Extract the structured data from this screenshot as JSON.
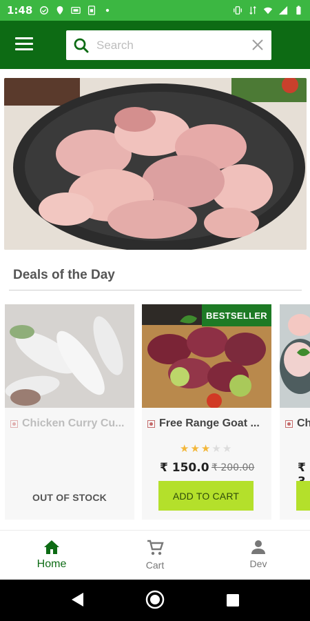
{
  "status_bar": {
    "time": "1:48"
  },
  "header": {
    "search_placeholder": "Search"
  },
  "section": {
    "title": "Deals of the Day"
  },
  "deals": [
    {
      "name": "Chicken Curry Cu...",
      "status": "OUT OF STOCK"
    },
    {
      "name": "Free Range Goat ...",
      "badge": "BESTSELLER",
      "rating": 3,
      "rating_max": 5,
      "price": "₹ 150.0",
      "mrp": "₹ 200.00",
      "button": "ADD TO CART"
    },
    {
      "name": "Ch",
      "price": "₹ 3"
    }
  ],
  "bottom_nav": {
    "items": [
      {
        "label": "Home",
        "icon": "home-icon",
        "active": true
      },
      {
        "label": "Cart",
        "icon": "cart-icon",
        "active": false
      },
      {
        "label": "Dev",
        "icon": "person-icon",
        "active": false
      }
    ]
  },
  "colors": {
    "status_bar": "#3cb742",
    "app_bar": "#0d6b14",
    "accent_button": "#b4e02b",
    "star": "#f3b73a"
  }
}
